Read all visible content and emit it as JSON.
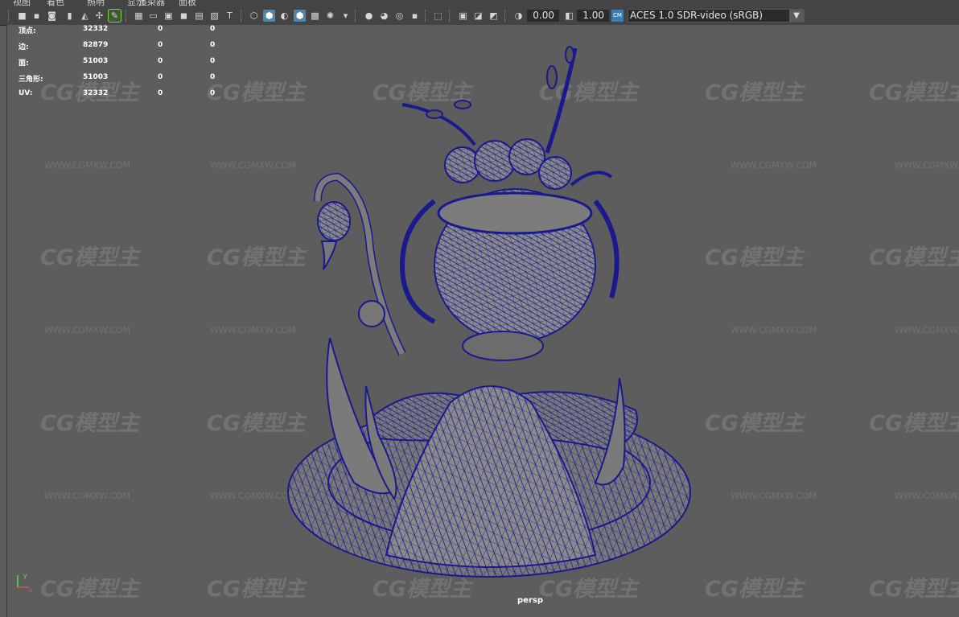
{
  "menu": [
    "视图",
    "着色",
    "照明",
    "显示",
    "渲染器",
    "面板"
  ],
  "toolbar": {
    "icons": [
      "camera-icon",
      "camera-attr-icon",
      "bookmark-icon",
      "image-plane-icon",
      "grid-icon",
      "film-gate-icon",
      "resolution-gate-icon",
      "gate-mask-icon",
      "field-chart-icon",
      "safe-action-icon",
      "safe-title-icon",
      "wireframe-icon",
      "smooth-shade-icon",
      "wireframe-on-shaded-icon",
      "textured-icon",
      "lighting-icon",
      "shadows-icon",
      "ao-icon",
      "motion-blur-icon",
      "anti-alias-icon",
      "dof-icon",
      "isolate-icon",
      "xray-icon",
      "xray-joints-icon",
      "backface-icon",
      "exposure-icon",
      "gamma-icon",
      "color-management-icon"
    ],
    "exposure_value": "0.00",
    "gamma_value": "1.00",
    "color_space": "ACES 1.0 SDR-video (sRGB)"
  },
  "hud": {
    "rows": [
      {
        "label": "顶点:",
        "v1": "32332",
        "v2": "0",
        "v3": "0"
      },
      {
        "label": "边:",
        "v1": "82879",
        "v2": "0",
        "v3": "0"
      },
      {
        "label": "面:",
        "v1": "51003",
        "v2": "0",
        "v3": "0"
      },
      {
        "label": "三角形:",
        "v1": "51003",
        "v2": "0",
        "v3": "0"
      },
      {
        "label": "UV:",
        "v1": "32332",
        "v2": "0",
        "v3": "0"
      }
    ]
  },
  "watermark": {
    "logo": "CG模型主",
    "url": "WWW.CGMXW.COM"
  },
  "viewport": {
    "camera_name": "persp",
    "axis_y": "y",
    "axis_x": "x"
  },
  "colors": {
    "wire": "#1a1a8c",
    "viewport_bg": "#5d5d5d",
    "toolbar_bg": "#444444",
    "accent": "#5285a6"
  }
}
